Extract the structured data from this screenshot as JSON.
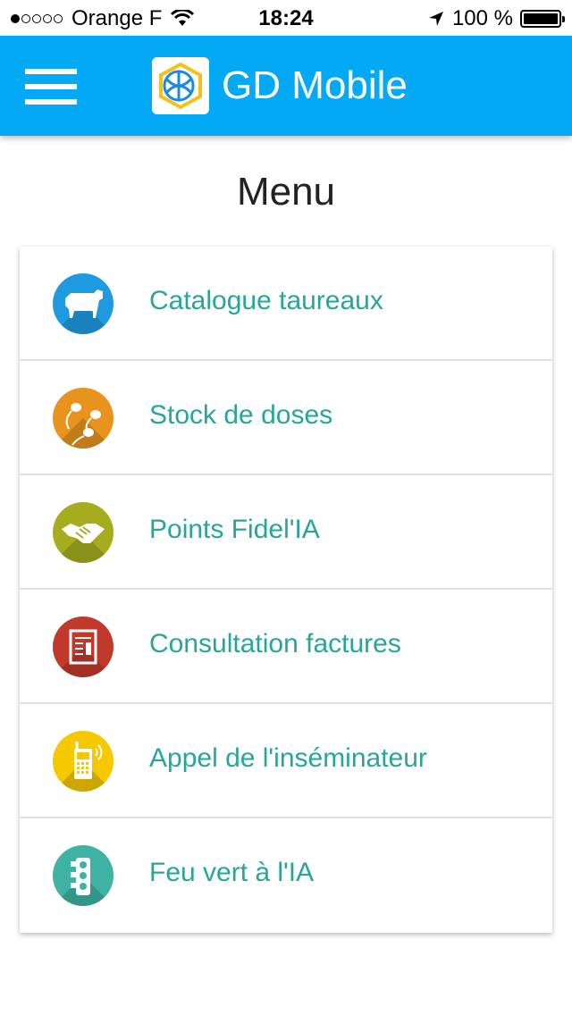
{
  "status_bar": {
    "carrier": "Orange F",
    "time": "18:24",
    "battery": "100 %"
  },
  "app_bar": {
    "title": "GD Mobile"
  },
  "page": {
    "title": "Menu"
  },
  "menu": {
    "items": [
      {
        "label": "Catalogue taureaux",
        "icon": "cow-icon",
        "color": "#1e9be0"
      },
      {
        "label": "Stock de doses",
        "icon": "sperm-icon",
        "color": "#e8931e"
      },
      {
        "label": "Points Fidel'IA",
        "icon": "handshake-icon",
        "color": "#a5ad1f"
      },
      {
        "label": "Consultation factures",
        "icon": "invoice-icon",
        "color": "#c1392b"
      },
      {
        "label": "Appel de l'inséminateur",
        "icon": "phone-icon",
        "color": "#f5c800"
      },
      {
        "label": "Feu vert à l'IA",
        "icon": "traffic-light-icon",
        "color": "#3fb3a3"
      }
    ]
  },
  "colors": {
    "app_bar": "#03a9f4",
    "label": "#26a69a"
  }
}
